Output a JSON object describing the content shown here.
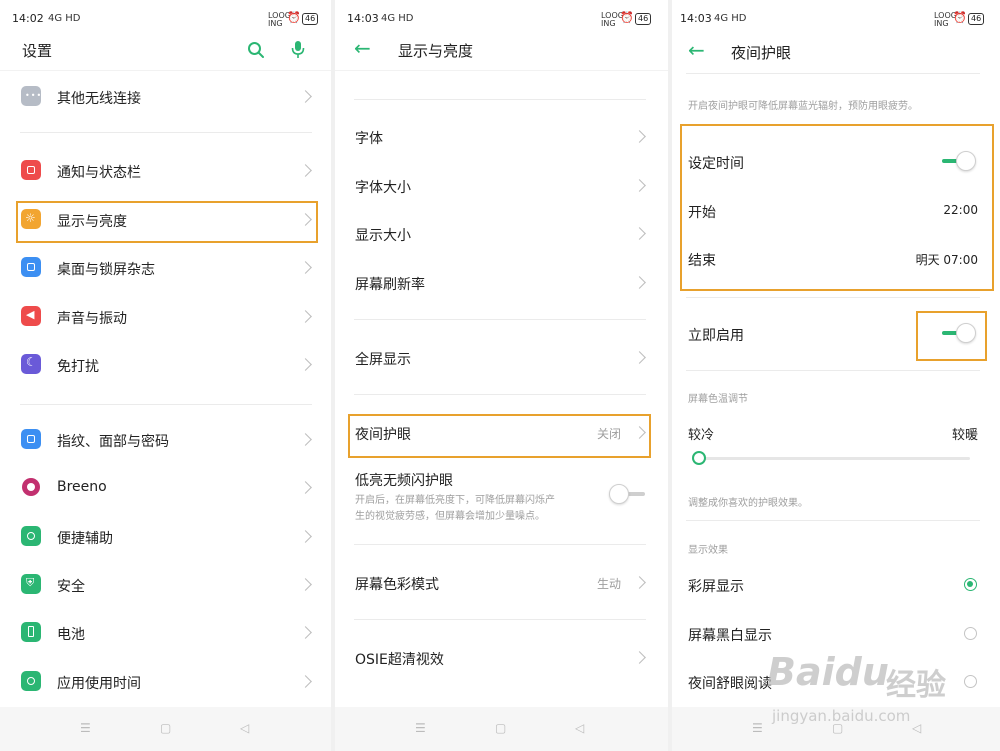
{
  "colors": {
    "accent": "#2bb673",
    "highlight": "#e8a12d"
  },
  "screen1": {
    "status": {
      "time": "14:02",
      "signal": "4G HD",
      "right": "LOOG ING",
      "battery": "46"
    },
    "title": "设置",
    "items": [
      {
        "label": "其他无线连接",
        "icon": "more-icon",
        "color": "#b6bcc6"
      },
      {
        "label": "通知与状态栏",
        "icon": "notification-icon",
        "color": "#ee4b4b"
      },
      {
        "label": "显示与亮度",
        "icon": "brightness-icon",
        "color": "#f2a531"
      },
      {
        "label": "桌面与锁屏杂志",
        "icon": "wallpaper-icon",
        "color": "#3c8ff2"
      },
      {
        "label": "声音与振动",
        "icon": "sound-icon",
        "color": "#ee4b4b"
      },
      {
        "label": "免打扰",
        "icon": "moon-icon",
        "color": "#6a5ad8"
      },
      {
        "label": "指纹、面部与密码",
        "icon": "fingerprint-icon",
        "color": "#3c8ff2"
      },
      {
        "label": "Breeno",
        "icon": "breeno-icon",
        "color": "#c2306f"
      },
      {
        "label": "便捷辅助",
        "icon": "assist-icon",
        "color": "#2bb673"
      },
      {
        "label": "安全",
        "icon": "shield-icon",
        "color": "#2bb673"
      },
      {
        "label": "电池",
        "icon": "battery-icon",
        "color": "#2bb673"
      },
      {
        "label": "应用使用时间",
        "icon": "timer-icon",
        "color": "#2bb673"
      }
    ]
  },
  "screen2": {
    "status": {
      "time": "14:03",
      "signal": "4G HD",
      "right": "LOOG ING",
      "battery": "46"
    },
    "title": "显示与亮度",
    "items": {
      "font": "字体",
      "font_size": "字体大小",
      "display_size": "显示大小",
      "refresh_rate": "屏幕刷新率",
      "fullscreen": "全屏显示",
      "night_eye": "夜间护眼",
      "night_eye_value": "关闭",
      "flicker": "低亮无频闪护眼",
      "flicker_desc_1": "开启后，在屏幕低亮度下，可降低屏幕闪烁产",
      "flicker_desc_2": "生的视觉疲劳感，但屏幕会增加少量噪点。",
      "color_mode": "屏幕色彩模式",
      "color_mode_value": "生动",
      "osie": "OSIE超清视效"
    }
  },
  "screen3": {
    "status": {
      "time": "14:03",
      "signal": "4G HD",
      "right": "LOOG ING",
      "battery": "46"
    },
    "title": "夜间护眼",
    "description": "开启夜间护眼可降低屏幕蓝光辐射，预防用眼疲劳。",
    "schedule": "设定时间",
    "start_label": "开始",
    "start_value": "22:00",
    "end_label": "结束",
    "end_value": "明天 07:00",
    "enable_now": "立即启用",
    "temp_section": "屏幕色温调节",
    "cold": "较冷",
    "warm": "较暖",
    "temp_level": 0.0,
    "temp_hint": "调整成你喜欢的护眼效果。",
    "effect_section": "显示效果",
    "effects": [
      {
        "label": "彩屏显示",
        "selected": true
      },
      {
        "label": "屏幕黑白显示",
        "selected": false
      },
      {
        "label": "夜间舒眼阅读",
        "selected": false
      }
    ]
  },
  "watermark": {
    "brand": "Baidu",
    "cn": "经验",
    "url": "jingyan.baidu.com"
  }
}
